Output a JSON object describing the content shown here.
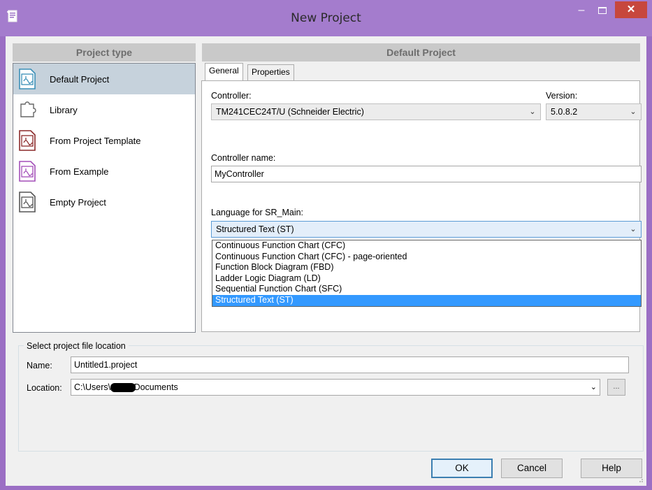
{
  "window": {
    "title": "New Project",
    "app_icon": "new-document-icon",
    "controls": {
      "minimize": "–",
      "maximize": "maximize-icon",
      "close": "✕"
    },
    "accent": "#a47ccd",
    "close_color": "#c7473d"
  },
  "project_type": {
    "header": "Project type",
    "items": [
      {
        "label": "Default Project",
        "icon": "cfc-blue-icon",
        "color": "#3a8fb7",
        "selected": true
      },
      {
        "label": "Library",
        "icon": "puzzle-icon",
        "color": "#666666",
        "selected": false
      },
      {
        "label": "From Project Template",
        "icon": "cfc-darkred-icon",
        "color": "#8b2a2a",
        "selected": false
      },
      {
        "label": "From Example",
        "icon": "cfc-purple-icon",
        "color": "#a34fb8",
        "selected": false
      },
      {
        "label": "Empty Project",
        "icon": "cfc-gray-icon",
        "color": "#555555",
        "selected": false
      }
    ]
  },
  "default_project": {
    "header": "Default Project",
    "tabs": [
      {
        "label": "General",
        "active": true
      },
      {
        "label": "Properties",
        "active": false
      }
    ],
    "controller_label": "Controller:",
    "controller_value": "TM241CEC24T/U (Schneider Electric)",
    "version_label": "Version:",
    "version_value": "5.0.8.2",
    "controller_name_label": "Controller name:",
    "controller_name_value": "MyController",
    "language_label": "Language for SR_Main:",
    "language_value": "Structured Text (ST)",
    "language_options": [
      "Continuous Function Chart (CFC)",
      "Continuous Function Chart (CFC) - page-oriented",
      "Function Block Diagram (FBD)",
      "Ladder Logic Diagram (LD)",
      "Sequential Function Chart (SFC)",
      "Structured Text (ST)"
    ],
    "language_selected_index": 5
  },
  "location": {
    "caption": "Select project file location",
    "name_label": "Name:",
    "name_value": "Untitled1.project",
    "location_label": "Location:",
    "location_value_prefix": "C:\\Users\\",
    "location_value_suffix": "\\Documents",
    "browse_label": "..."
  },
  "buttons": {
    "ok": "OK",
    "cancel": "Cancel",
    "help": "Help"
  }
}
